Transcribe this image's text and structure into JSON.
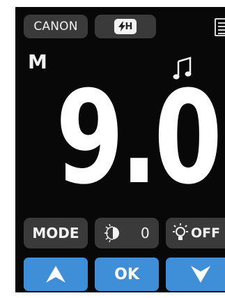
{
  "top": {
    "brand_label": "CANON",
    "flash_mode_label": "H",
    "flash_icon": "flash-icon",
    "menu_icon": "menu-icon"
  },
  "status": {
    "mode_letter": "M",
    "sound_icon": "music-note-icon"
  },
  "display": {
    "value": "9.0"
  },
  "controls": {
    "mode_label": "MODE",
    "brightness_icon": "brightness-icon",
    "brightness_value": "0",
    "lamp_icon": "lamp-icon",
    "lamp_label": "OFF"
  },
  "nav": {
    "up_icon": "up-arrow-icon",
    "ok_label": "OK",
    "down_icon": "down-arrow-icon"
  },
  "colors": {
    "screen_bg": "#080808",
    "pill_bg": "#3a3a3a",
    "button_blue": "#3f8fd8",
    "text": "#f2f2f2"
  }
}
